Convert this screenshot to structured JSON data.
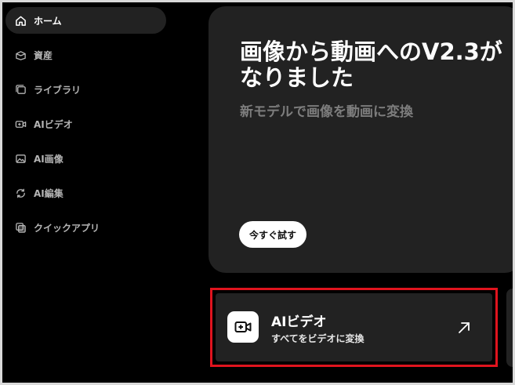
{
  "sidebar": {
    "items": [
      {
        "label": "ホーム",
        "icon": "home-icon",
        "active": true
      },
      {
        "label": "資産",
        "icon": "assets-icon",
        "active": false
      },
      {
        "label": "ライブラリ",
        "icon": "library-icon",
        "active": false
      },
      {
        "label": "AIビデオ",
        "icon": "video-camera-icon",
        "active": false
      },
      {
        "label": "AI画像",
        "icon": "image-icon",
        "active": false
      },
      {
        "label": "AI編集",
        "icon": "edit-icon",
        "active": false
      },
      {
        "label": "クイックアプリ",
        "icon": "quick-app-icon",
        "active": false
      }
    ]
  },
  "hero": {
    "title": "画像から動画へのV2.3が\nなりました",
    "subtitle": "新モデルで画像を動画に変換",
    "cta_label": "今すぐ試す"
  },
  "feature_card": {
    "title": "AIビデオ",
    "subtitle": "すべてをビデオに変換",
    "icon": "video-camera-icon",
    "arrow_icon": "arrow-up-right-icon"
  },
  "colors": {
    "background": "#000000",
    "panel": "#222222",
    "highlight": "#e0141e",
    "muted_text": "#7d7d7d"
  }
}
